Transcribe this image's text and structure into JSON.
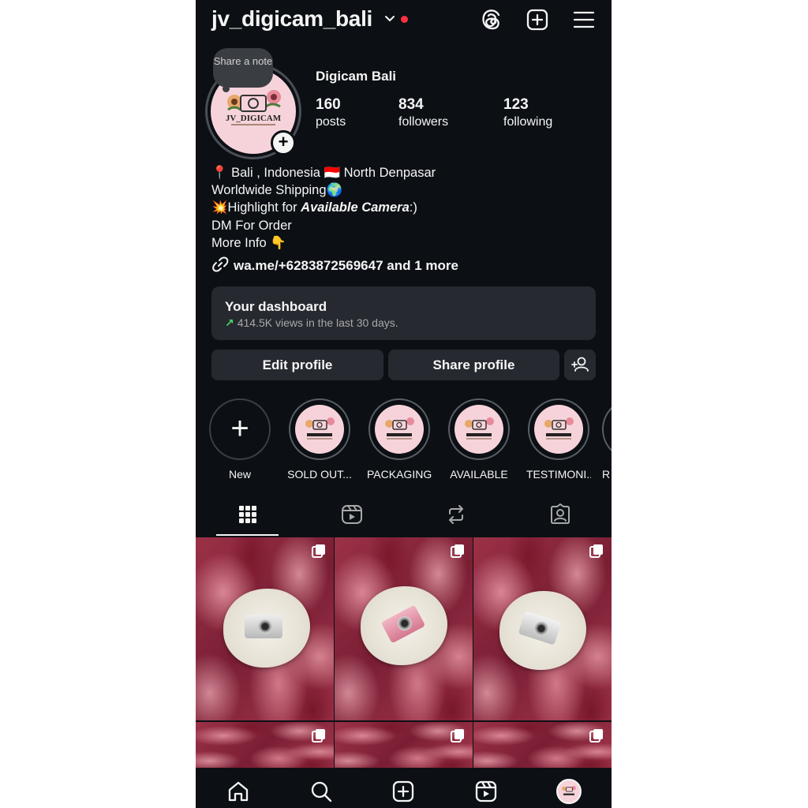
{
  "header": {
    "username": "jv_digicam_bali",
    "icons": [
      "threads-icon",
      "create-icon",
      "menu-icon"
    ]
  },
  "profile": {
    "note_label": "Share a note",
    "full_name": "Digicam Bali",
    "logo_text": "JV_DIGICAM",
    "stats": [
      {
        "value": "160",
        "label": "posts"
      },
      {
        "value": "834",
        "label": "followers"
      },
      {
        "value": "123",
        "label": "following"
      }
    ],
    "bio": {
      "line1": "📍 Bali , Indonesia 🇮🇩 North Denpasar",
      "line2": "Worldwide Shipping🌍",
      "line3_prefix": "💥Highlight for ",
      "line3_emph": "Available Camera",
      "line3_suffix": ":)",
      "line4": "DM For Order",
      "line5": "More Info 👇"
    },
    "link": "wa.me/+6283872569647 and 1 more"
  },
  "dashboard": {
    "title": "Your dashboard",
    "subtitle": "414.5K views in the last 30 days."
  },
  "buttons": {
    "edit": "Edit profile",
    "share": "Share profile"
  },
  "highlights": [
    {
      "label": "New"
    },
    {
      "label": "SOLD OUT..."
    },
    {
      "label": "PACKAGING"
    },
    {
      "label": "AVAILABLE"
    },
    {
      "label": "TESTIMONI..."
    },
    {
      "label": "R"
    }
  ],
  "tabs": [
    "grid",
    "reels",
    "reposts",
    "tagged"
  ],
  "colors": {
    "background": "#0c1014",
    "surface": "#262a30",
    "accent_green": "#4cd964",
    "notification_red": "#ff3040"
  }
}
